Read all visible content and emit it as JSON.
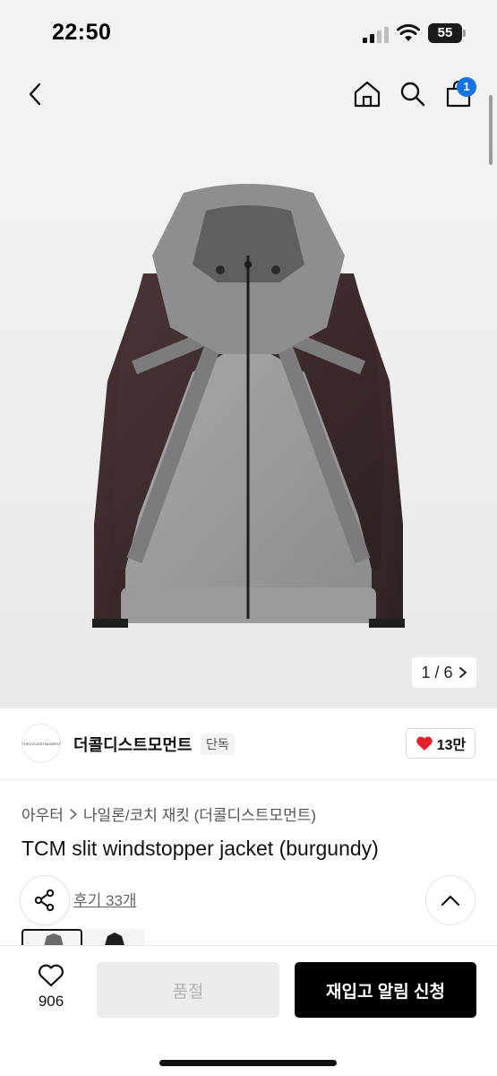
{
  "status_bar": {
    "time": "22:50",
    "battery": "55",
    "icons": [
      "signal-icon",
      "wifi-icon",
      "battery-icon"
    ]
  },
  "nav": {
    "icons": [
      "back-icon",
      "home-icon",
      "search-icon",
      "cart-icon"
    ],
    "cart_count": "1"
  },
  "gallery": {
    "current": "1",
    "total": "6",
    "counter_text": "1 / 6",
    "image_subject": "jacket"
  },
  "seller": {
    "logo_text": "THECOLDISTMOMENT",
    "name": "더콜디스트모먼트",
    "badge": "단독",
    "likes": "13만"
  },
  "product": {
    "breadcrumb": [
      "아우터",
      "나일론/코치 재킷 (더콜디스트모먼트)"
    ],
    "title": "TCM slit windstopper jacket (burgundy)",
    "review_text": "후기 33개"
  },
  "bottom_bar": {
    "wish_count": "906",
    "soldout_label": "품절",
    "restock_label": "재입고 알림 신청"
  },
  "colors": {
    "accent_blue": "#1673e6",
    "heart_red": "#e5232f",
    "primary_black": "#000000",
    "disabled_gray": "#ececec"
  }
}
